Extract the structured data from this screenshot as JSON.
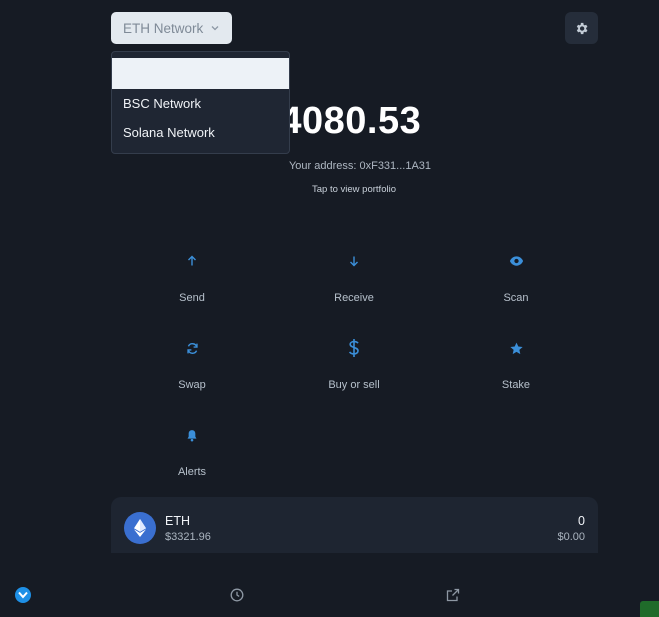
{
  "header": {
    "network_label": "ETH Network"
  },
  "dropdown": {
    "items": [
      "",
      "BSC Network",
      "Solana Network"
    ]
  },
  "wallet": {
    "balance": "$4080.53",
    "address": "Your address: 0xF331...1A31",
    "tap_hint": "Tap to view portfolio"
  },
  "actions": [
    {
      "label": "Send",
      "icon": "arrow-up-icon"
    },
    {
      "label": "Receive",
      "icon": "arrow-down-icon"
    },
    {
      "label": "Scan",
      "icon": "eye-icon"
    },
    {
      "label": "Swap",
      "icon": "refresh-icon"
    },
    {
      "label": "Buy or sell",
      "icon": "dollar-icon"
    },
    {
      "label": "Stake",
      "icon": "star-icon"
    },
    {
      "label": "Alerts",
      "icon": "bell-icon"
    }
  ],
  "tokens": [
    {
      "symbol": "ETH",
      "price": "$3321.96",
      "amount": "0",
      "value": "$0.00",
      "icon": "ethereum-icon"
    }
  ],
  "colors": {
    "accent": "#3b8fd9",
    "background": "#161b24",
    "card": "#1e2531"
  }
}
